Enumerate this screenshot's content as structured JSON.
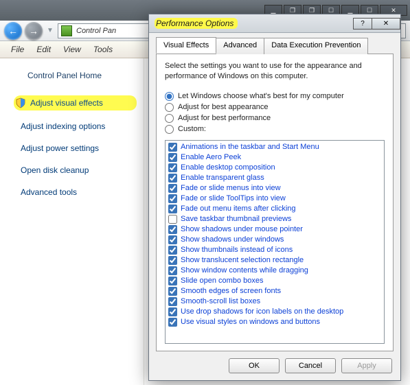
{
  "bg": {
    "breadcrumb": "Control Pan",
    "menus": [
      "File",
      "Edit",
      "View",
      "Tools"
    ],
    "home": "Control Panel Home",
    "links": [
      {
        "label": "Adjust visual effects",
        "highlight": true,
        "shield": true
      },
      {
        "label": "Adjust indexing options",
        "highlight": false,
        "shield": false
      },
      {
        "label": "Adjust power settings",
        "highlight": false,
        "shield": false
      },
      {
        "label": "Open disk cleanup",
        "highlight": false,
        "shield": false
      },
      {
        "label": "Advanced tools",
        "highlight": false,
        "shield": false
      }
    ]
  },
  "dialog": {
    "title": "Performance Options",
    "tabs": [
      "Visual Effects",
      "Advanced",
      "Data Execution Prevention"
    ],
    "active_tab": 0,
    "description": "Select the settings you want to use for the appearance and performance of Windows on this computer.",
    "radios": [
      "Let Windows choose what's best for my computer",
      "Adjust for best appearance",
      "Adjust for best performance",
      "Custom:"
    ],
    "selected_radio": 0,
    "effects": [
      {
        "label": "Animations in the taskbar and Start Menu",
        "checked": true
      },
      {
        "label": "Enable Aero Peek",
        "checked": true
      },
      {
        "label": "Enable desktop composition",
        "checked": true
      },
      {
        "label": "Enable transparent glass",
        "checked": true
      },
      {
        "label": "Fade or slide menus into view",
        "checked": true
      },
      {
        "label": "Fade or slide ToolTips into view",
        "checked": true
      },
      {
        "label": "Fade out menu items after clicking",
        "checked": true
      },
      {
        "label": "Save taskbar thumbnail previews",
        "checked": false
      },
      {
        "label": "Show shadows under mouse pointer",
        "checked": true
      },
      {
        "label": "Show shadows under windows",
        "checked": true
      },
      {
        "label": "Show thumbnails instead of icons",
        "checked": true
      },
      {
        "label": "Show translucent selection rectangle",
        "checked": true
      },
      {
        "label": "Show window contents while dragging",
        "checked": true
      },
      {
        "label": "Slide open combo boxes",
        "checked": true
      },
      {
        "label": "Smooth edges of screen fonts",
        "checked": true
      },
      {
        "label": "Smooth-scroll list boxes",
        "checked": true
      },
      {
        "label": "Use drop shadows for icon labels on the desktop",
        "checked": true
      },
      {
        "label": "Use visual styles on windows and buttons",
        "checked": true
      }
    ],
    "buttons": {
      "ok": "OK",
      "cancel": "Cancel",
      "apply": "Apply"
    }
  }
}
